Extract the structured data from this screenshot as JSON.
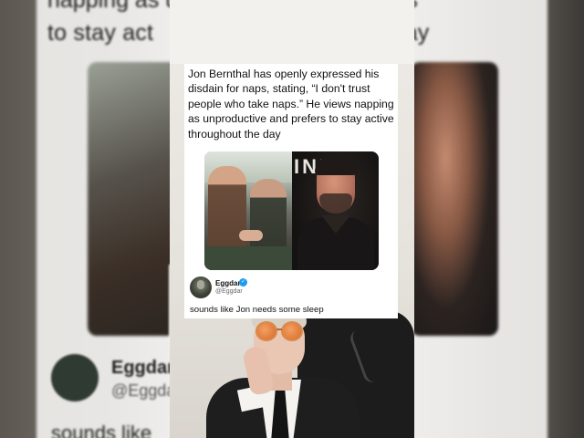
{
  "background": {
    "top_text": "napping as unproductive and prefers",
    "line_left": "to stay act",
    "line_right": "day",
    "author_name": "Eggdar",
    "author_handle": "@Eggdar",
    "reply_fragment": "sounds like"
  },
  "post": {
    "caption": "Jon Bernthal has openly expressed his disdain for naps, stating, “I don't trust people who take naps.” He views napping as unproductive and prefers to stay active throughout the day",
    "images": [
      {
        "description_icon": "photo-signing-icon"
      },
      {
        "description_icon": "portrait-icon",
        "backdrop_text": "INE"
      }
    ]
  },
  "reply": {
    "author_name": "Eggdar",
    "author_handle": "@Eggdar",
    "verified_icon": "verified-badge-icon",
    "text": "sounds like Jon needs some sleep"
  },
  "colors": {
    "verified": "#1d9bf0",
    "card_bg": "#ffffff",
    "text": "#111111"
  }
}
